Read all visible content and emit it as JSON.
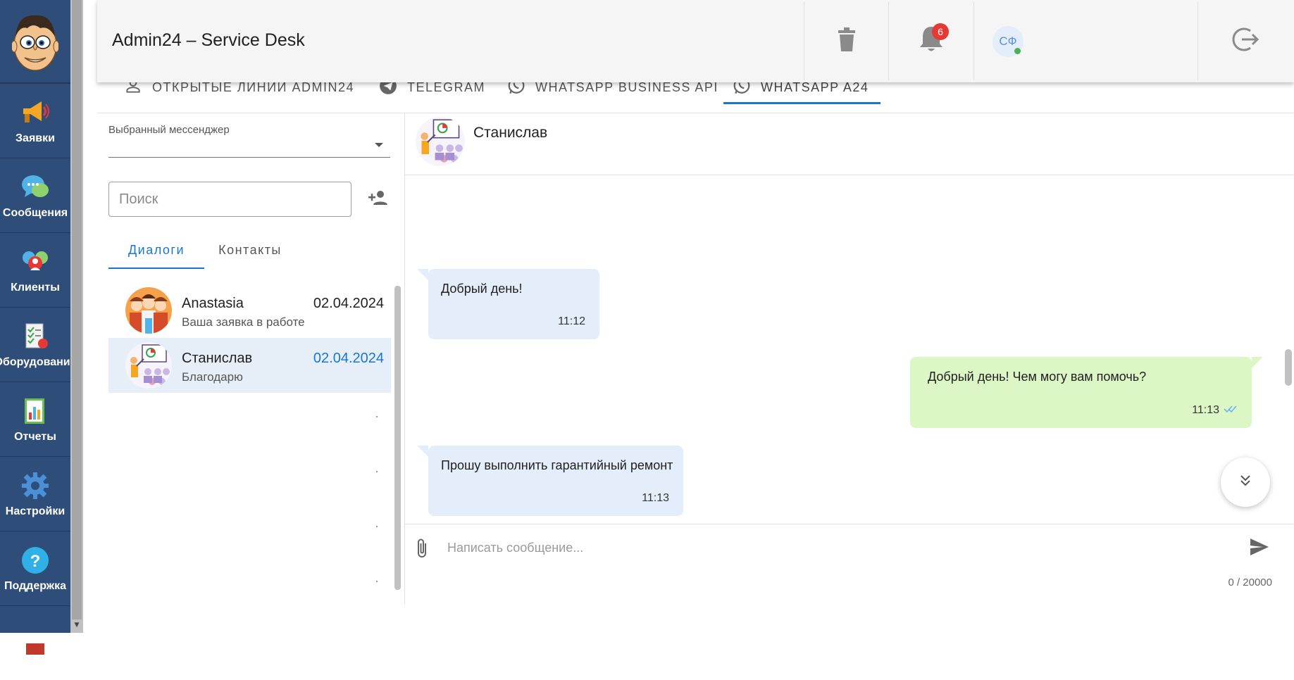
{
  "sidebar": {
    "items": [
      {
        "label": "Заявки",
        "icon": "megaphone-icon"
      },
      {
        "label": "Сообщения",
        "icon": "chat-bubbles-icon"
      },
      {
        "label": "Клиенты",
        "icon": "clients-icon"
      },
      {
        "label": "Оборудование",
        "icon": "equipment-checklist-icon"
      },
      {
        "label": "Отчеты",
        "icon": "reports-chart-icon"
      },
      {
        "label": "Настройки",
        "icon": "gear-icon"
      },
      {
        "label": "Поддержка",
        "icon": "help-icon"
      }
    ]
  },
  "header": {
    "title": "Admin24 – Service Desk",
    "notifications_count": "6",
    "user_initials": "СФ"
  },
  "channel_tabs": [
    {
      "label": "Открытые линии Admin24"
    },
    {
      "label": "Telegram"
    },
    {
      "label": "WhatsApp Business API"
    },
    {
      "label": "WhatsApp A24",
      "active": true
    }
  ],
  "dialogs_panel": {
    "messenger_select_label": "Выбранный мессенджер",
    "messenger_select_value": "",
    "search_placeholder": "Поиск",
    "tabs": {
      "dialogs": "Диалоги",
      "contacts": "Контакты"
    },
    "dialogs": [
      {
        "name": "Anastasia",
        "preview": "Ваша заявка в работе",
        "date": "02.04.2024"
      },
      {
        "name": "Станислав",
        "preview": "Благодарю",
        "date": "02.04.2024",
        "selected": true
      }
    ]
  },
  "chat": {
    "contact_name": "Станислав",
    "messages": [
      {
        "direction": "in",
        "text": "Добрый день!",
        "time": "11:12"
      },
      {
        "direction": "out",
        "text": "Добрый день! Чем могу вам помочь?",
        "time": "11:13"
      },
      {
        "direction": "in",
        "text": "Прошу выполнить гарантийный ремонт",
        "time": "11:13"
      }
    ],
    "composer": {
      "placeholder": "Написать сообщение...",
      "counter": "0 / 20000"
    }
  },
  "colors": {
    "sidebar": "#2f4d79",
    "accent": "#1976d2",
    "incoming_bubble": "#e3eefa",
    "outgoing_bubble": "#dcf7c5",
    "badge": "#e53935"
  }
}
